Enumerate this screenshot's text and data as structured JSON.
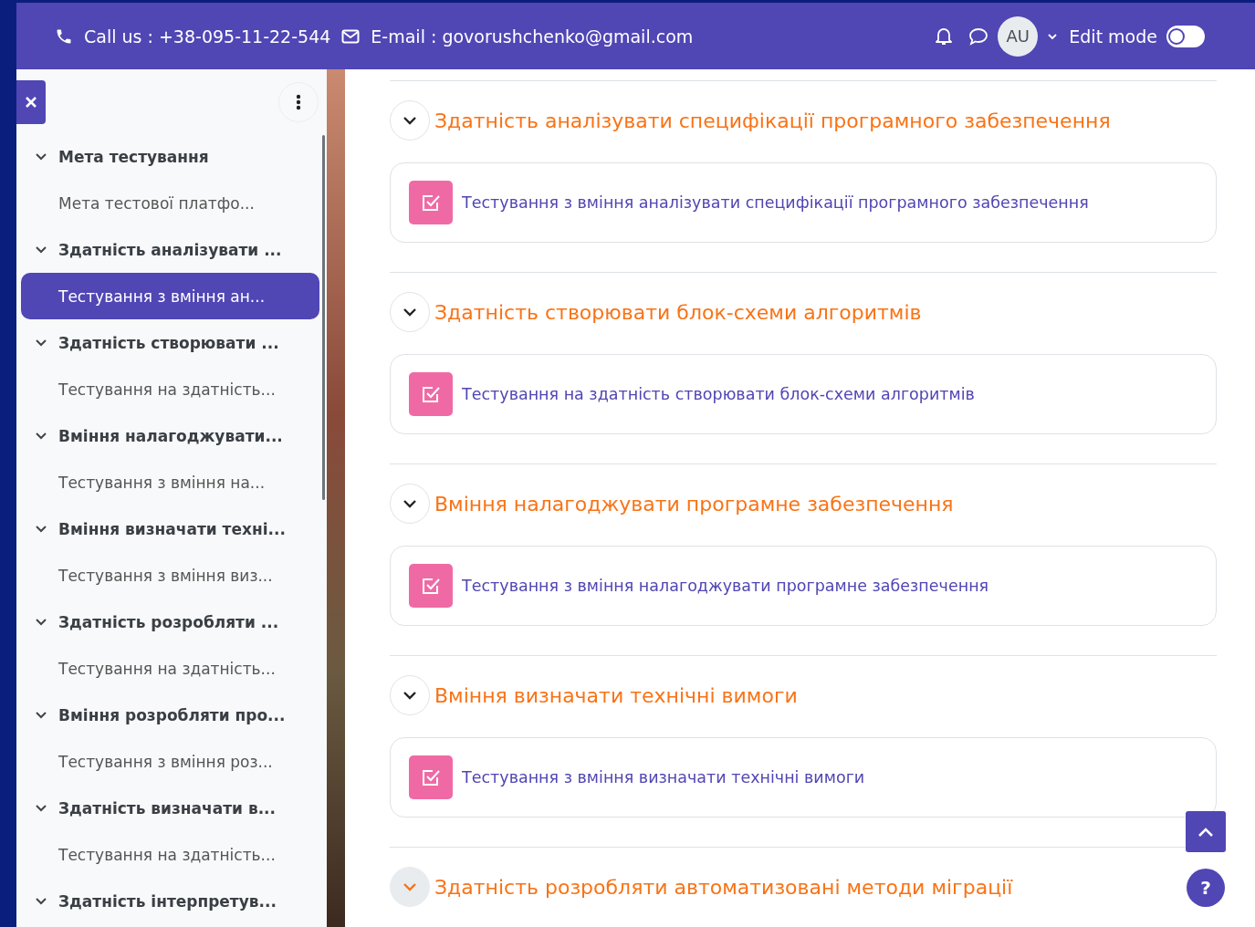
{
  "header": {
    "phone": "Call us : +38-095-11-22-544",
    "email": "E-mail : govorushchenko@gmail.com",
    "avatar": "AU",
    "edit_mode": {
      "label": "Edit mode",
      "on": false
    }
  },
  "sidebar": {
    "sections": [
      {
        "title": "Мета тестування",
        "expanded": true,
        "children": [
          {
            "title": "Мета тестової платфо...",
            "selected": false
          }
        ]
      },
      {
        "title": "Здатність аналізувати ...",
        "expanded": true,
        "children": [
          {
            "title": "Тестування з вміння ан...",
            "selected": true
          }
        ]
      },
      {
        "title": "Здатність створювати ...",
        "expanded": true,
        "children": [
          {
            "title": "Тестування на здатність...",
            "selected": false
          }
        ]
      },
      {
        "title": "Вміння налагоджувати...",
        "expanded": true,
        "children": [
          {
            "title": "Тестування з вміння на...",
            "selected": false
          }
        ]
      },
      {
        "title": "Вміння визначати техні...",
        "expanded": true,
        "children": [
          {
            "title": "Тестування з вміння виз...",
            "selected": false
          }
        ]
      },
      {
        "title": "Здатність розробляти ...",
        "expanded": true,
        "children": [
          {
            "title": "Тестування на здатність...",
            "selected": false
          }
        ]
      },
      {
        "title": "Вміння розробляти про...",
        "expanded": true,
        "children": [
          {
            "title": "Тестування з вміння роз...",
            "selected": false
          }
        ]
      },
      {
        "title": "Здатність визначати в...",
        "expanded": true,
        "children": [
          {
            "title": "Тестування на здатність...",
            "selected": false
          }
        ]
      },
      {
        "title": "Здатність інтерпретув...",
        "expanded": true
      }
    ]
  },
  "sections": [
    {
      "title": "Здатність аналізувати специфікації програмного забезпечення",
      "focused": false,
      "activities": [
        {
          "label": "Тестування з вміння аналізувати специфікації програмного забезпечення"
        }
      ]
    },
    {
      "title": "Здатність створювати блок-схеми алгоритмів",
      "focused": false,
      "activities": [
        {
          "label": "Тестування на здатність створювати блок-схеми алгоритмів"
        }
      ]
    },
    {
      "title": "Вміння налагоджувати програмне забезпечення",
      "focused": false,
      "activities": [
        {
          "label": "Тестування з вміння налагоджувати програмне забезпечення"
        }
      ]
    },
    {
      "title": "Вміння визначати технічні вимоги",
      "focused": false,
      "activities": [
        {
          "label": "Тестування з вміння визначати технічні вимоги"
        }
      ]
    },
    {
      "title": "Здатність розробляти автоматизовані методи міграції",
      "focused": true
    }
  ],
  "help": {
    "label": "?"
  }
}
